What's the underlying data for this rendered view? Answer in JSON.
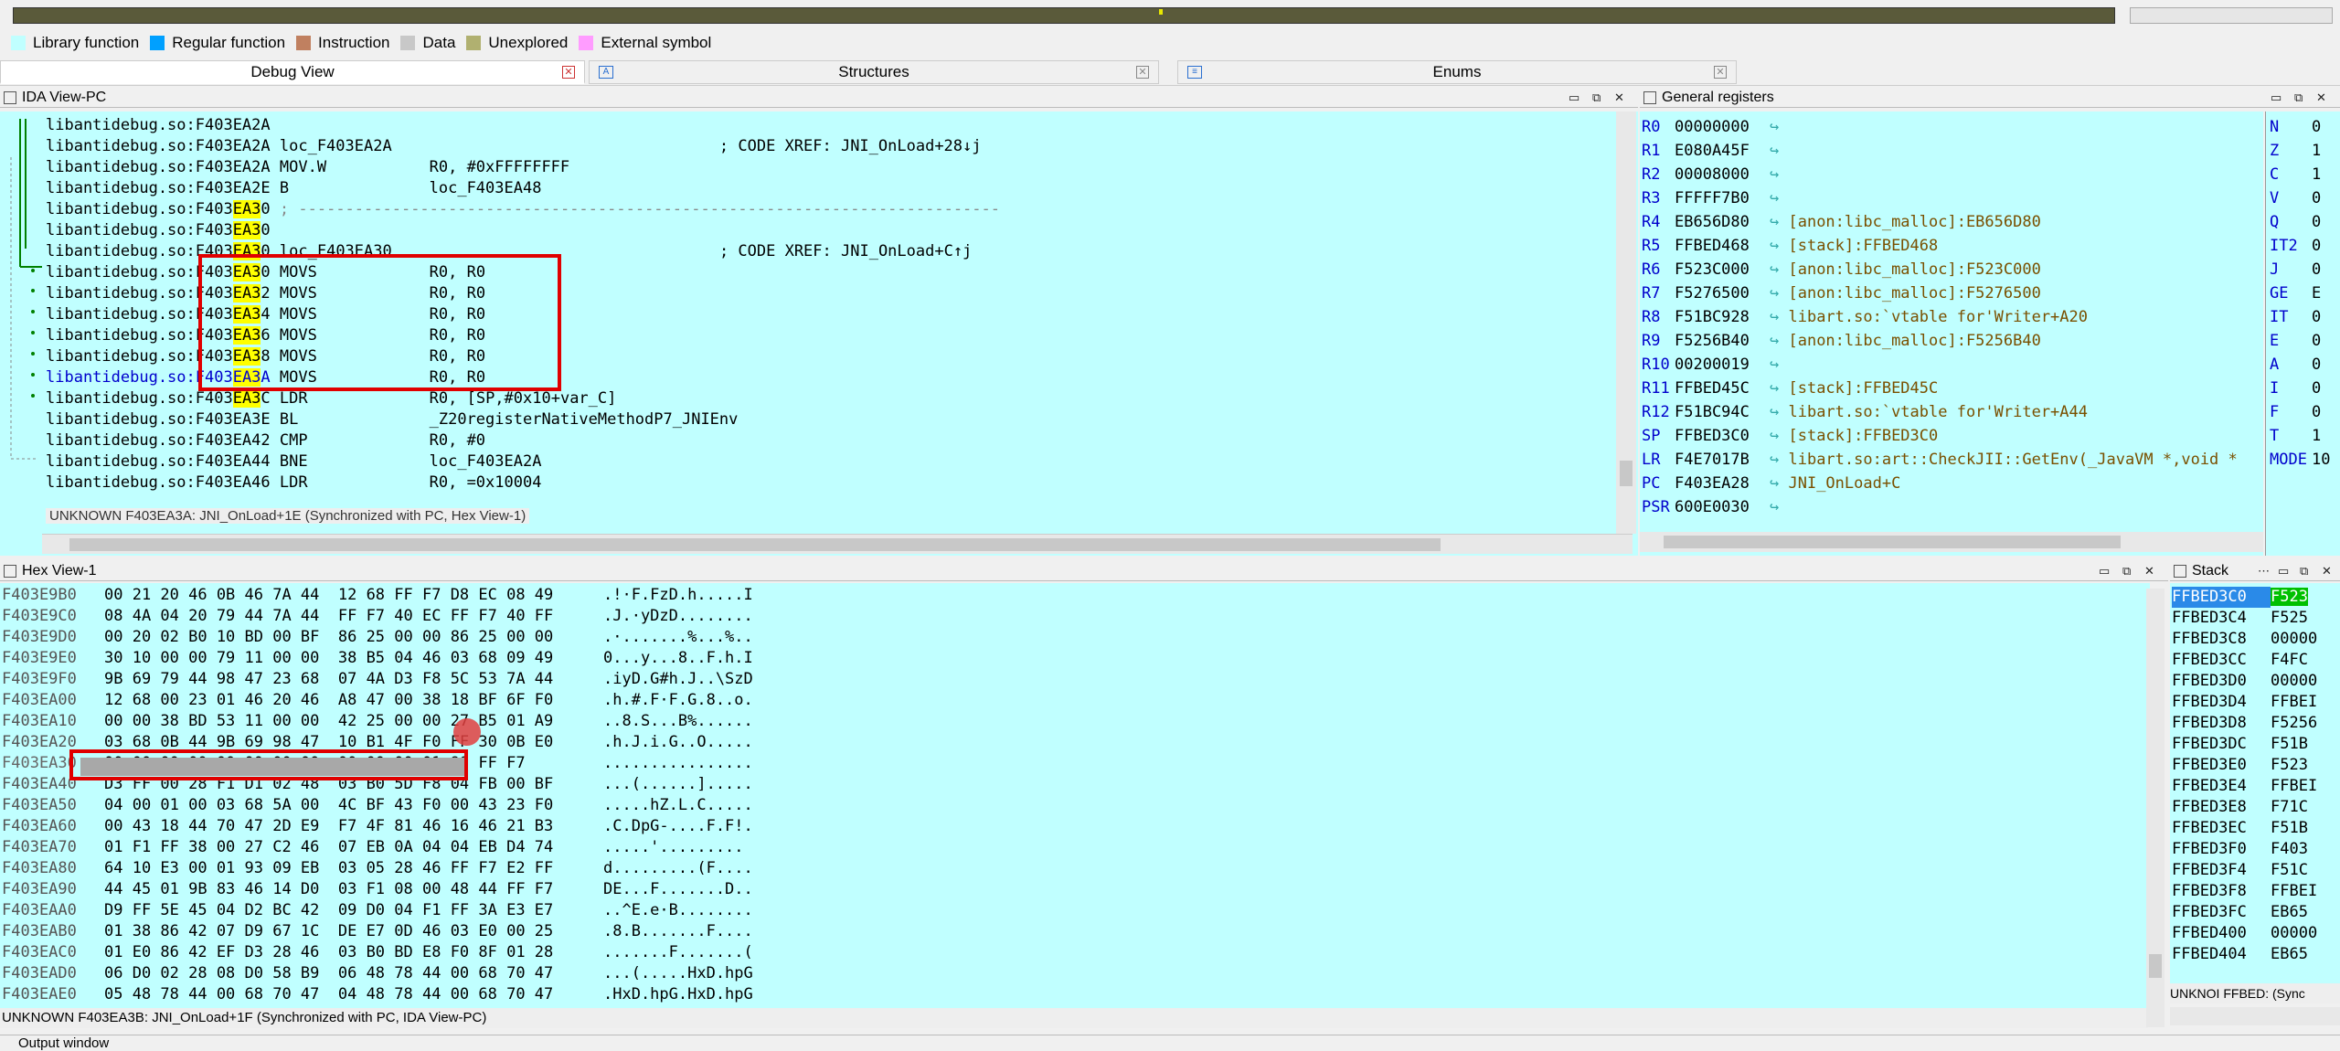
{
  "legend": [
    {
      "label": "Library function",
      "color": "#c0ffff"
    },
    {
      "label": "Regular function",
      "color": "#00a0ff"
    },
    {
      "label": "Instruction",
      "color": "#c08060"
    },
    {
      "label": "Data",
      "color": "#c8c8c8"
    },
    {
      "label": "Unexplored",
      "color": "#b0b070"
    },
    {
      "label": "External symbol",
      "color": "#ff9cff"
    }
  ],
  "tabs": {
    "debug": "Debug View",
    "structures": "Structures",
    "enums": "Enums"
  },
  "ida": {
    "title": "IDA View-PC",
    "status": "UNKNOWN F403EA3A: JNI_OnLoad+1E (Synchronized with PC, Hex View-1)",
    "lines": [
      {
        "a": "libantidebug.so:F403EA2A",
        "b": ""
      },
      {
        "a": "libantidebug.so:F403EA2A",
        "b": " loc_F403EA2A                                   ; CODE XREF: JNI_OnLoad+28↓j"
      },
      {
        "a": "libantidebug.so:F403EA2A",
        "b": " MOV.W           R0, #0xFFFFFFFF"
      },
      {
        "a": "libantidebug.so:F403EA2E",
        "b": " B               loc_F403EA48"
      },
      {
        "a": "libantidebug.so:F403EA30",
        "b": " ; ---------------------------------------------------------------------------"
      },
      {
        "a": "libantidebug.so:F403EA30",
        "b": ""
      },
      {
        "a": "libantidebug.so:F403EA30",
        "b": " loc_F403EA30                                   ; CODE XREF: JNI_OnLoad+C↑j"
      },
      {
        "a": "libantidebug.so:F403EA30",
        "b": " MOVS            R0, R0"
      },
      {
        "a": "libantidebug.so:F403EA32",
        "b": " MOVS            R0, R0"
      },
      {
        "a": "libantidebug.so:F403EA34",
        "b": " MOVS            R0, R0"
      },
      {
        "a": "libantidebug.so:F403EA36",
        "b": " MOVS            R0, R0"
      },
      {
        "a": "libantidebug.so:F403EA38",
        "b": " MOVS            R0, R0"
      },
      {
        "a": "libantidebug.so:F403EA3A",
        "b": " MOVS            R0, R0"
      },
      {
        "a": "libantidebug.so:F403EA3C",
        "b": " LDR             R0, [SP,#0x10+var_C]"
      },
      {
        "a": "libantidebug.so:F403EA3E",
        "b": " BL              _Z20registerNativeMethodP7_JNIEnv"
      },
      {
        "a": "libantidebug.so:F403EA42",
        "b": " CMP             R0, #0"
      },
      {
        "a": "libantidebug.so:F403EA44",
        "b": " BNE             loc_F403EA2A"
      },
      {
        "a": "libantidebug.so:F403EA46",
        "b": " LDR             R0, =0x10004"
      }
    ]
  },
  "regs": {
    "title": "General registers",
    "rows": [
      {
        "n": "R0",
        "v": "00000000",
        "t": ""
      },
      {
        "n": "R1",
        "v": "E080A45F",
        "t": ""
      },
      {
        "n": "R2",
        "v": "00008000",
        "t": ""
      },
      {
        "n": "R3",
        "v": "FFFFF7B0",
        "t": ""
      },
      {
        "n": "R4",
        "v": "EB656D80",
        "t": "[anon:libc_malloc]:EB656D80"
      },
      {
        "n": "R5",
        "v": "FFBED468",
        "t": "[stack]:FFBED468"
      },
      {
        "n": "R6",
        "v": "F523C000",
        "t": "[anon:libc_malloc]:F523C000"
      },
      {
        "n": "R7",
        "v": "F5276500",
        "t": "[anon:libc_malloc]:F5276500"
      },
      {
        "n": "R8",
        "v": "F51BC928",
        "t": "libart.so:`vtable for'Writer+A20"
      },
      {
        "n": "R9",
        "v": "F5256B40",
        "t": "[anon:libc_malloc]:F5256B40"
      },
      {
        "n": "R10",
        "v": "00200019",
        "t": ""
      },
      {
        "n": "R11",
        "v": "FFBED45C",
        "t": "[stack]:FFBED45C"
      },
      {
        "n": "R12",
        "v": "F51BC94C",
        "t": "libart.so:`vtable for'Writer+A44"
      },
      {
        "n": "SP",
        "v": "FFBED3C0",
        "t": "[stack]:FFBED3C0"
      },
      {
        "n": "LR",
        "v": "F4E7017B",
        "t": "libart.so:art::CheckJII::GetEnv(_JavaVM *,void *"
      },
      {
        "n": "PC",
        "v": "F403EA28",
        "t": "JNI_OnLoad+C"
      },
      {
        "n": "PSR",
        "v": "600E0030",
        "t": ""
      }
    ],
    "flags": [
      [
        "N",
        "0"
      ],
      [
        "Z",
        "1"
      ],
      [
        "C",
        "1"
      ],
      [
        "V",
        "0"
      ],
      [
        "Q",
        "0"
      ],
      [
        "IT2",
        "0"
      ],
      [
        "J",
        "0"
      ],
      [
        "GE",
        "E"
      ],
      [
        "IT",
        "0"
      ],
      [
        "E",
        "0"
      ],
      [
        "A",
        "0"
      ],
      [
        "I",
        "0"
      ],
      [
        "F",
        "0"
      ],
      [
        "T",
        "1"
      ],
      [
        "MODE",
        "10"
      ]
    ]
  },
  "hex": {
    "title": "Hex View-1",
    "status": "UNKNOWN F403EA3B: JNI_OnLoad+1F (Synchronized with PC, IDA View-PC)",
    "rows": [
      {
        "a": "F403E9B0",
        "h": "00 21 20 46 0B 46 7A 44  12 68 FF F7 D8 EC 08 49",
        "s": ".!·F.FzD.h.....I"
      },
      {
        "a": "F403E9C0",
        "h": "08 4A 04 20 79 44 7A 44  FF F7 40 EC FF F7 40 FF",
        "s": ".J.·yDzD........"
      },
      {
        "a": "F403E9D0",
        "h": "00 20 02 B0 10 BD 00 BF  86 25 00 00 86 25 00 00",
        "s": ".·.......%...%.."
      },
      {
        "a": "F403E9E0",
        "h": "30 10 00 00 79 11 00 00  38 B5 04 46 03 68 09 49",
        "s": "0...y...8..F.h.I"
      },
      {
        "a": "F403E9F0",
        "h": "9B 69 79 44 98 47 23 68  07 4A D3 F8 5C 53 7A 44",
        "s": ".iyD.G#h.J..\\SzD"
      },
      {
        "a": "F403EA00",
        "h": "12 68 00 23 01 46 20 46  A8 47 00 38 18 BF 6F F0",
        "s": ".h.#.F·F.G.8..o."
      },
      {
        "a": "F403EA10",
        "h": "00 00 38 BD 53 11 00 00  42 25 00 00 27 B5 01 A9",
        "s": "..8.S...B%......"
      },
      {
        "a": "F403EA20",
        "h": "03 68 0B 44 9B 69 98 47  10 B1 4F F0 FF 30 0B E0",
        "s": ".h.J.i.G..O....."
      },
      {
        "a": "F403EA30",
        "h": "00 00 00 00 00 00 00 00  00 00 00 01 98 FF F7",
        "s": "................"
      },
      {
        "a": "F403EA40",
        "h": "D3 FF 00 28 F1 D1 02 48  03 B0 5D F8 04 FB 00 BF",
        "s": "...(......]....."
      },
      {
        "a": "F403EA50",
        "h": "04 00 01 00 03 68 5A 00  4C BF 43 F0 00 43 23 F0",
        "s": ".....hZ.L.C....."
      },
      {
        "a": "F403EA60",
        "h": "00 43 18 44 70 47 2D E9  F7 4F 81 46 16 46 21 B3",
        "s": ".C.DpG-....F.F!."
      },
      {
        "a": "F403EA70",
        "h": "01 F1 FF 38 00 27 C2 46  07 EB 0A 04 04 EB D4 74",
        "s": ".....'........."
      },
      {
        "a": "F403EA80",
        "h": "64 10 E3 00 01 93 09 EB  03 05 28 46 FF F7 E2 FF",
        "s": "d.........(F...."
      },
      {
        "a": "F403EA90",
        "h": "44 45 01 9B 83 46 14 D0  03 F1 08 00 48 44 FF F7",
        "s": "DE...F.......D.."
      },
      {
        "a": "F403EAA0",
        "h": "D9 FF 5E 45 04 D2 BC 42  09 D0 04 F1 FF 3A E3 E7",
        "s": "..^E.e·B........"
      },
      {
        "a": "F403EAB0",
        "h": "01 38 86 42 07 D9 67 1C  DE E7 0D 46 03 E0 00 25",
        "s": ".8.B.......F...."
      },
      {
        "a": "F403EAC0",
        "h": "01 E0 86 42 EF D3 28 46  03 B0 BD E8 F0 8F 01 28",
        "s": ".......F.......("
      },
      {
        "a": "F403EAD0",
        "h": "06 D0 02 28 08 D0 58 B9  06 48 78 44 00 68 70 47",
        "s": "...(.....HxD.hpG"
      },
      {
        "a": "F403EAE0",
        "h": "05 48 78 44 00 68 70 47  04 48 78 44 00 68 70 47",
        "s": ".HxD.hpG.HxD.hpG"
      }
    ]
  },
  "stack": {
    "title": "Stack",
    "status": "UNKNOI FFBED: (Sync",
    "rows": [
      [
        "FFBED3C0",
        "F523"
      ],
      [
        "FFBED3C4",
        "F525"
      ],
      [
        "FFBED3C8",
        "00000"
      ],
      [
        "FFBED3CC",
        "F4FC"
      ],
      [
        "FFBED3D0",
        "00000"
      ],
      [
        "FFBED3D4",
        "FFBEI"
      ],
      [
        "FFBED3D8",
        "F5256"
      ],
      [
        "FFBED3DC",
        "F51B"
      ],
      [
        "FFBED3E0",
        "F523"
      ],
      [
        "FFBED3E4",
        "FFBEI"
      ],
      [
        "FFBED3E8",
        "F71C"
      ],
      [
        "FFBED3EC",
        "F51B"
      ],
      [
        "FFBED3F0",
        "F403"
      ],
      [
        "FFBED3F4",
        "F51C"
      ],
      [
        "FFBED3F8",
        "FFBEI"
      ],
      [
        "FFBED3FC",
        "EB65"
      ],
      [
        "FFBED400",
        "00000"
      ],
      [
        "FFBED404",
        "EB65"
      ]
    ]
  },
  "output": {
    "title": "Output window"
  }
}
